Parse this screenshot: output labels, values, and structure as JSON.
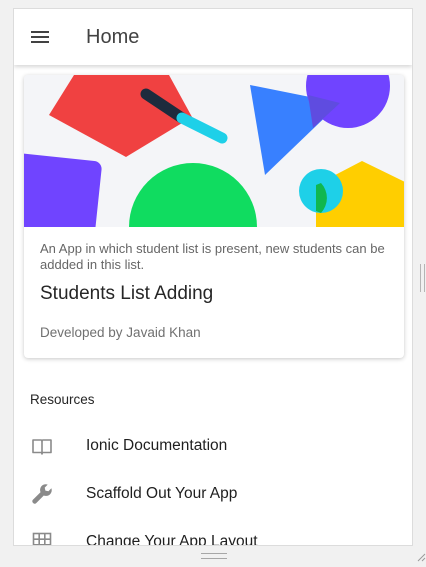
{
  "toolbar": {
    "menu_icon": "menu-icon",
    "title": "Home"
  },
  "card": {
    "subtitle": "An App in which student list is present, new students can be addded in this list.",
    "title": "Students List Adding",
    "body": "Developed by Javaid Khan",
    "colors": {
      "red": "#f04141",
      "navy": "#1e2b3d",
      "cyan": "#1ed0e8",
      "blue": "#3880ff",
      "purple": "#7044ff",
      "green": "#10dc60",
      "yellow": "#ffce00"
    }
  },
  "resources": {
    "header": "Resources",
    "items": [
      {
        "icon": "book-icon",
        "label": "Ionic Documentation"
      },
      {
        "icon": "wrench-icon",
        "label": "Scaffold Out Your App"
      },
      {
        "icon": "grid-icon",
        "label": "Change Your App Layout"
      }
    ]
  }
}
